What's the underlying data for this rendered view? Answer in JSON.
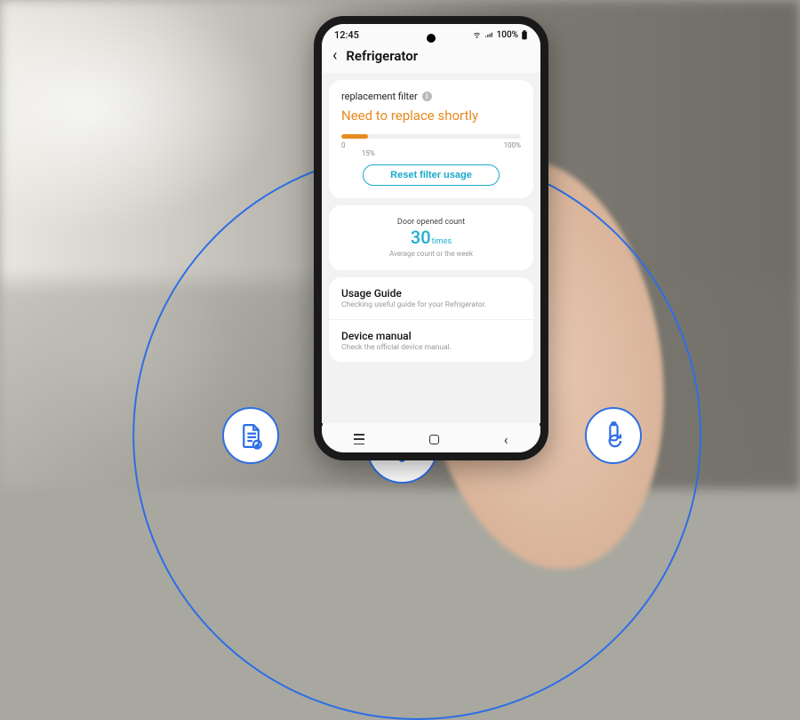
{
  "status_bar": {
    "time": "12:45",
    "battery_text": "100%"
  },
  "header": {
    "title": "Refrigerator"
  },
  "filter_card": {
    "label": "replacement filter",
    "status": "Need to replace shortly",
    "progress_percent": 15,
    "scale_min": "0",
    "scale_tick": "15%",
    "scale_max": "100%",
    "reset_label": "Reset filter usage"
  },
  "door_card": {
    "title": "Door opened count",
    "count": "30",
    "unit": "times",
    "subtitle": "Average count or the week"
  },
  "list": [
    {
      "title": "Usage Guide",
      "subtitle": "Checking useful guide for your Refrigerator."
    },
    {
      "title": "Device manual",
      "subtitle": "Check the official device manual."
    }
  ],
  "badges": {
    "left": "document-check-icon",
    "center": "wifi-icon",
    "right": "water-filter-refresh-icon"
  },
  "colors": {
    "accent_warning": "#e78a1e",
    "accent_teal": "#1aa8c9",
    "brand_blue": "#2d6ee6"
  }
}
